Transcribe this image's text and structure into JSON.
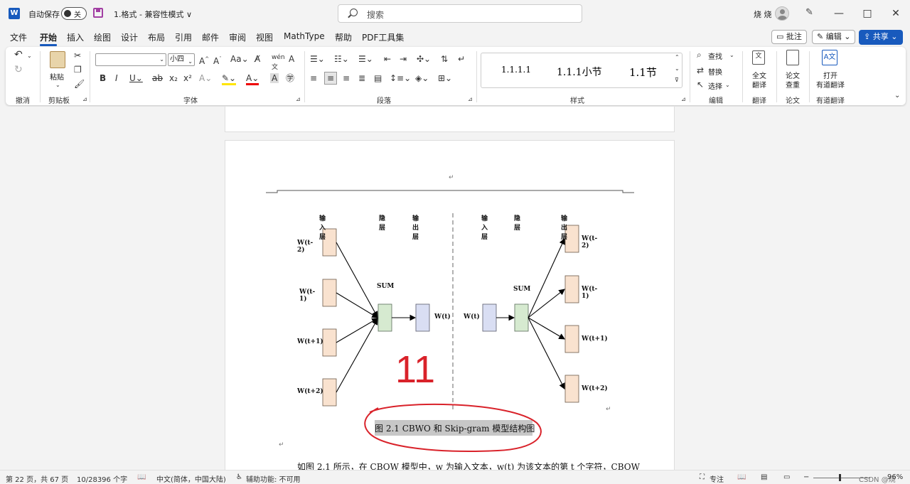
{
  "titlebar": {
    "app_logo": "W",
    "autosave_label": "自动保存",
    "autosave_state": "关",
    "doc_title": "1.格式 - 兼容性模式 ∨",
    "search_placeholder": "搜索",
    "user_name": "烧 烧",
    "window_controls": [
      "—",
      "□",
      "✕"
    ]
  },
  "menu": {
    "items": [
      "文件",
      "开始",
      "插入",
      "绘图",
      "设计",
      "布局",
      "引用",
      "邮件",
      "审阅",
      "视图",
      "MathType",
      "帮助",
      "PDF工具集"
    ],
    "active": "开始",
    "comment_button": "批注",
    "edit_button": "编辑",
    "share_button": "共享"
  },
  "ribbon": {
    "groups": {
      "undo": "撤消",
      "clipboard": "剪贴板",
      "font": "字体",
      "paragraph": "段落",
      "styles": "样式",
      "editing": "编辑",
      "translate": "翻译",
      "paper": "论文",
      "youdao": "有道翻译"
    },
    "paste_label": "粘贴",
    "font_size": "小四",
    "styles": [
      "1.1.1.1",
      "1.1.1小节",
      "1.1节"
    ],
    "find": "查找",
    "replace": "替换",
    "select": "选择",
    "full_translate": [
      "全文",
      "翻译"
    ],
    "paper_check": [
      "论文",
      "查重"
    ],
    "open_youdao": [
      "打开",
      "有道翻译"
    ]
  },
  "figure": {
    "cbow": {
      "input_label": "输入层",
      "hidden_label": "隐层",
      "output_label": "输出层",
      "sum_label": "SUM",
      "inputs": [
        "W(t-2)",
        "W(t-1)",
        "W(t+1)",
        "W(t+2)"
      ],
      "output": "W(t)"
    },
    "skipgram": {
      "input_label": "输入层",
      "hidden_label": "隐层",
      "output_label": "输出层",
      "sum_label": "SUM",
      "input": "W(t)",
      "outputs": [
        "W(t-2)",
        "W(t-1)",
        "W(t+1)",
        "W(t+2)"
      ]
    },
    "annotation": "11",
    "colors": {
      "input_box": "#f9e2cf",
      "hidden_box": "#d6ead0",
      "output_box": "#d9def3",
      "annotation": "#d9222a"
    }
  },
  "document": {
    "caption": "图 2.1 CBWO 和 Skip-gram 模型结构图",
    "body_line": "如图 2.1 所示，在 CBOW 模型中，w 为输入文本，w(t) 为该文本的第 t 个字符，CBOW",
    "para_mark": "↵"
  },
  "status": {
    "page": "第 22 页，共 67 页",
    "words": "10/28396 个字",
    "language": "中文(简体，中国大陆)",
    "accessibility": "辅助功能: 不可用",
    "focus": "专注",
    "zoom": "96%",
    "watermark": "CSDN @烧"
  }
}
